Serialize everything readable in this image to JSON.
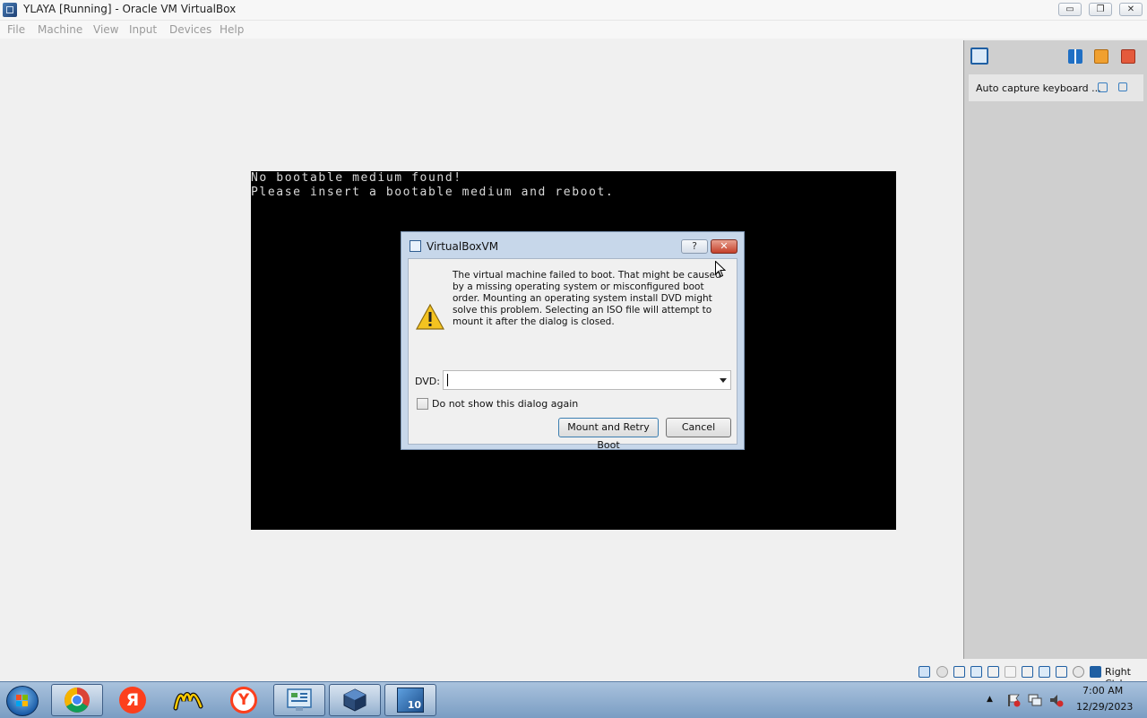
{
  "window": {
    "title": "YLAYA [Running] - Oracle VM VirtualBox",
    "minimize_glyph": "▭",
    "restore_glyph": "❐",
    "close_glyph": "✕"
  },
  "menubar": {
    "items": [
      "File",
      "Machine",
      "View",
      "Input",
      "Devices",
      "Help"
    ]
  },
  "vm_screen": {
    "lines": [
      "No bootable medium found!",
      "Please insert a bootable medium and reboot."
    ]
  },
  "dialog": {
    "title": "VirtualBoxVM",
    "help_glyph": "?",
    "close_glyph": "✕",
    "message": "The virtual machine failed to boot. That might be caused by a missing operating system or misconfigured boot order. Mounting an operating system install DVD might solve this problem. Selecting an ISO file will attempt to mount it after the dialog is closed.",
    "dvd_label": "DVD:",
    "dvd_value": "",
    "checkbox_label": "Do not show this dialog again",
    "checkbox_checked": false,
    "mount_button": "Mount and Retry Boot",
    "cancel_button": "Cancel"
  },
  "side_panel": {
    "notification_text": "Auto capture keyboard ..."
  },
  "status_bar": {
    "host_key": "Right Ctrl"
  },
  "taskbar": {
    "apps": [
      "chrome-icon",
      "yandex-ya-icon",
      "yandex-market-icon",
      "yandex-browser-icon",
      "control-panel-icon",
      "virtualbox-icon",
      "virtualbox-vm-icon"
    ],
    "yandex_glyph": "Я",
    "browser_glyph": "Y",
    "vm_badge": "10",
    "tray_arrow": "▲",
    "time": "7:00 AM",
    "date": "12/29/2023"
  }
}
